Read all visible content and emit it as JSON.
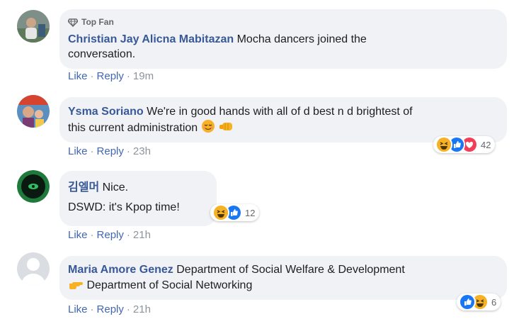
{
  "comments": [
    {
      "badge": "Top Fan",
      "author": "Christian Jay Alicna Mabitazan",
      "text_line1": "Mocha dancers joined the",
      "text_line2": "conversation.",
      "like": "Like",
      "reply": "Reply",
      "time": "19m"
    },
    {
      "author": "Ysma Soriano",
      "text_line1": "We're in good hands with all of d best n d brightest of",
      "text_line2": "this current administration",
      "like": "Like",
      "reply": "Reply",
      "time": "23h",
      "reactions": [
        "haha",
        "like",
        "love"
      ],
      "reaction_count": "42"
    },
    {
      "author": "김엘머",
      "text_line1": "Nice.",
      "text_line2": "DSWD: it's Kpop time!",
      "like": "Like",
      "reply": "Reply",
      "time": "21h",
      "reactions": [
        "haha",
        "like"
      ],
      "reaction_count": "12"
    },
    {
      "author": "Maria Amore Genez",
      "text_line1": "Department of Social Welfare & Development",
      "text_line2": "Department of Social Networking",
      "like": "Like",
      "reply": "Reply",
      "time": "21h",
      "reactions": [
        "like",
        "haha"
      ],
      "reaction_count": "6"
    }
  ],
  "colors": {
    "name": "#385898",
    "bubble": "#f0f2f5",
    "link": "#4267b2",
    "like_reaction": "#1877f2",
    "love_reaction": "#f33e58",
    "haha_reaction": "#f7b125"
  }
}
